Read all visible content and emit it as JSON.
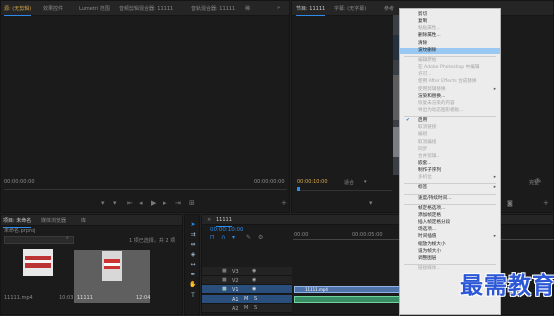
{
  "source_panel": {
    "tabs": [
      "源: (无剪辑)",
      "效果控件",
      "Lumetri 范围",
      "音频剪辑混合器: 11111",
      "音轨混合器: 11111",
      "稀"
    ],
    "timecode_left": "00:00:00:00",
    "timecode_right": "00:00:00:00"
  },
  "program_panel": {
    "tabs": [
      "节目: 11111",
      "字幕: (无字幕)",
      "参考"
    ],
    "timecode": "00:00:10:00",
    "fit_label": "适合",
    "quality_label": "完整"
  },
  "project_panel": {
    "tabs": [
      "项目: 未命名",
      "媒体浏览器",
      "库"
    ],
    "project_file": "未命名.prproj",
    "item_count": "1 项已选择，共 2 项",
    "items": [
      {
        "name": "11111.mp4",
        "duration": "10:03"
      },
      {
        "name": "11111",
        "duration": "12:04"
      }
    ]
  },
  "timeline": {
    "tab_label": "11111",
    "timecode": "00:00:10:00",
    "ruler": [
      "00:00",
      "00:00:05:00"
    ],
    "video_tracks": [
      "V3",
      "V2",
      "V1"
    ],
    "audio_tracks": [
      "A1",
      "A2",
      "A3"
    ],
    "clip_label": "11111.mp4"
  },
  "context_menu": {
    "items": [
      {
        "label": "剪切",
        "enabled": true
      },
      {
        "label": "复制",
        "enabled": true
      },
      {
        "label": "粘贴属性...",
        "enabled": false
      },
      {
        "label": "删除属性...",
        "enabled": true
      },
      {
        "label": "清除",
        "enabled": true
      },
      {
        "label": "波纹删除",
        "enabled": true,
        "highlighted": true
      },
      {
        "sep": true
      },
      {
        "label": "编辑原始",
        "enabled": false
      },
      {
        "label": "在 Adobe Photoshop 中编辑",
        "enabled": false
      },
      {
        "label": "许可...",
        "enabled": false
      },
      {
        "label": "使用 After Effects 合成替换",
        "enabled": false
      },
      {
        "label": "使用剪辑替换",
        "enabled": false,
        "submenu": true
      },
      {
        "label": "渲染和替换...",
        "enabled": true
      },
      {
        "label": "恢复未渲染的内容",
        "enabled": false
      },
      {
        "label": "导出为动态图形模板...",
        "enabled": false
      },
      {
        "sep": true
      },
      {
        "label": "启用",
        "enabled": true,
        "checked": true
      },
      {
        "label": "取消链接",
        "enabled": false
      },
      {
        "label": "编组",
        "enabled": false
      },
      {
        "label": "取消编组",
        "enabled": false
      },
      {
        "label": "同步",
        "enabled": false
      },
      {
        "label": "合并剪辑...",
        "enabled": false
      },
      {
        "label": "嵌套...",
        "enabled": true
      },
      {
        "label": "制作子序列",
        "enabled": true
      },
      {
        "label": "多机位",
        "enabled": false,
        "submenu": true
      },
      {
        "sep": true
      },
      {
        "label": "标签",
        "enabled": true,
        "submenu": true
      },
      {
        "sep": true
      },
      {
        "label": "速度/持续时间...",
        "enabled": true
      },
      {
        "sep": true
      },
      {
        "label": "帧定格选项...",
        "enabled": true
      },
      {
        "label": "添加帧定格",
        "enabled": true
      },
      {
        "label": "插入帧定格分段",
        "enabled": true
      },
      {
        "label": "场选项...",
        "enabled": true
      },
      {
        "label": "时间插值",
        "enabled": true,
        "submenu": true
      },
      {
        "label": "缩放为帧大小",
        "enabled": true
      },
      {
        "label": "设为帧大小",
        "enabled": true
      },
      {
        "label": "调整图层",
        "enabled": true
      },
      {
        "sep": true
      },
      {
        "label": "链接媒体...",
        "enabled": false
      }
    ]
  },
  "watermark": "最需教育",
  "colors": {
    "accent": "#2d8ceb",
    "menu_bg": "#ececec",
    "menu_highlight": "#99c9f2",
    "video_track": "#2a4f7c",
    "audio_clip": "#4f72a8"
  },
  "icons": [
    "play-icon",
    "step-back-icon",
    "step-forward-icon",
    "wrench-icon",
    "selection-tool-icon",
    "razor-tool-icon",
    "hand-tool-icon",
    "text-tool-icon",
    "eye-icon",
    "lock-icon",
    "search-icon",
    "camera-icon",
    "settings-icon"
  ]
}
